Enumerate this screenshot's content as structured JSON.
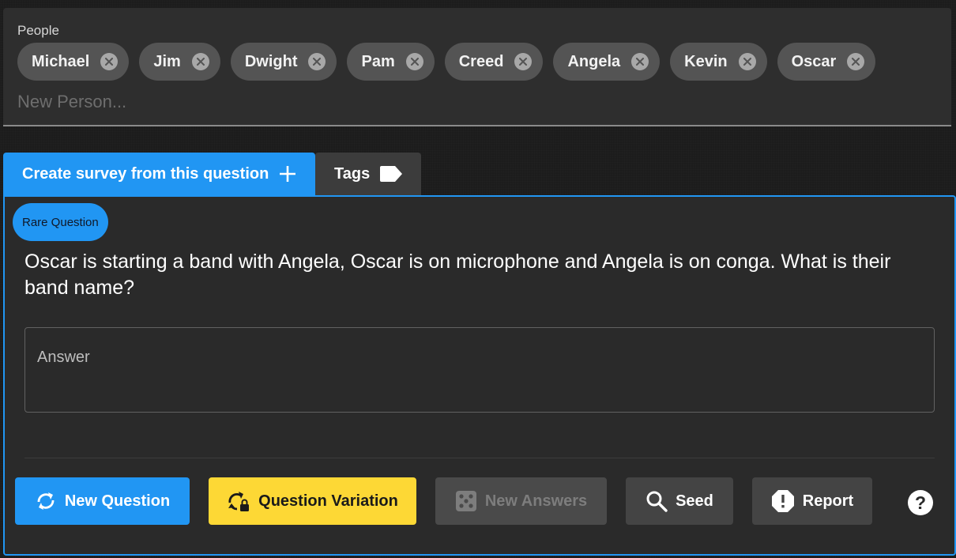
{
  "people": {
    "label": "People",
    "chips": [
      "Michael",
      "Jim",
      "Dwight",
      "Pam",
      "Creed",
      "Angela",
      "Kevin",
      "Oscar"
    ],
    "input_placeholder": "New Person..."
  },
  "tabs": {
    "create_survey": "Create survey from this question",
    "tags": "Tags"
  },
  "question": {
    "badge": "Rare Question",
    "text": "Oscar is starting a band with Angela, Oscar is on microphone and Angela is on conga. What is their band name?",
    "answer_label": "Answer",
    "answer_value": ""
  },
  "actions": {
    "new_question": "New Question",
    "question_variation": "Question Variation",
    "new_answers": "New Answers",
    "seed": "Seed",
    "report": "Report",
    "help": "?"
  },
  "colors": {
    "accent": "#2196f3",
    "variation": "#fdd835",
    "background": "#1c1c1c"
  },
  "icons": {
    "chip_remove": "close-circle-icon",
    "create_survey": "plus-icon",
    "tags": "tag-icon",
    "new_question": "refresh-icon",
    "question_variation": "lock-refresh-icon",
    "new_answers": "dice-icon",
    "seed": "search-icon",
    "report": "alert-octagon-icon",
    "help": "help-circle-icon"
  }
}
